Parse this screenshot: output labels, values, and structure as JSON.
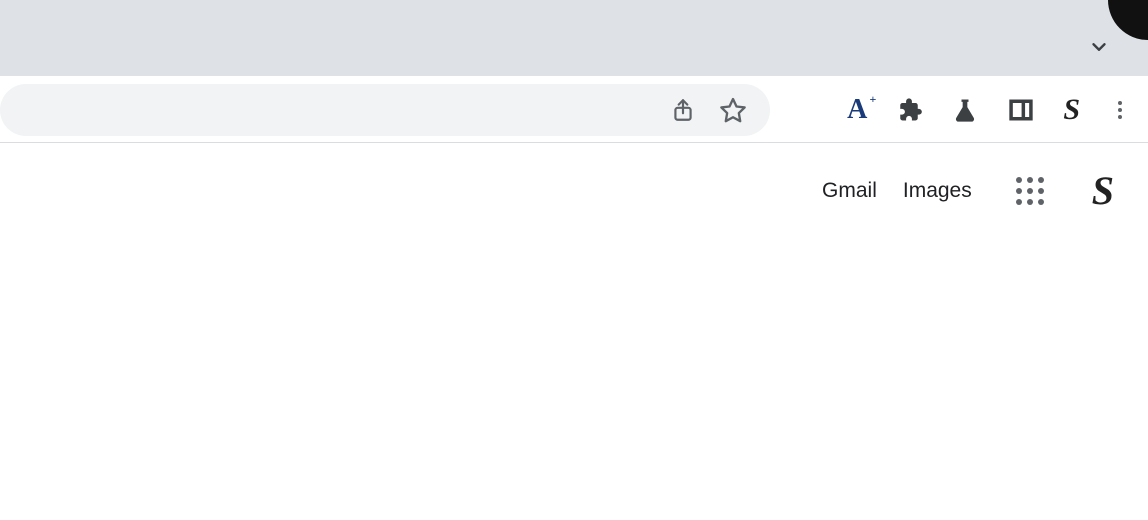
{
  "header": {
    "gmail_label": "Gmail",
    "images_label": "Images"
  },
  "icons": {
    "share": "share-icon",
    "star": "star-icon",
    "font_size": "font-size-icon",
    "extensions": "puzzle-icon",
    "labs": "flask-icon",
    "side_panel": "side-panel-icon",
    "profile": "profile-s-icon",
    "menu": "vertical-dots-icon",
    "chevron": "chevron-down-icon",
    "apps": "apps-grid-icon"
  },
  "colors": {
    "tab_strip_bg": "#dee1e6",
    "omnibox_bg": "#f1f3f4",
    "border": "#dadce0",
    "icon_gray": "#5f6368",
    "icon_dark": "#3c4043",
    "font_blue": "#1a3b7a"
  }
}
